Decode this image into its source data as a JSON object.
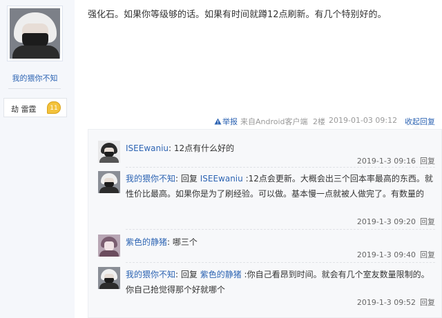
{
  "author": {
    "name": "我的猥你不知",
    "rank_name": "劫 雷霆",
    "level": "11"
  },
  "post": {
    "content": "强化石。如果你等级够的话。如果有时间就蹲12点刷新。有几个特别好的。",
    "report_label": "举报",
    "client": "来自Android客户端",
    "floor": "2楼",
    "time": "2019-01-03 09:12",
    "collapse_label": "收起回复"
  },
  "replies": [
    {
      "user": "ISEEwaniu",
      "prefix": "",
      "target": "",
      "text": ": 12点有什么好的",
      "time": "2019-1-3 09:16",
      "reply_label": "回复"
    },
    {
      "user": "我的猥你不知",
      "prefix": ": 回复 ",
      "target": "ISEEwaniu",
      "text": " :12点会更新。大概会出三个回本率最高的东西。就性价比最高。如果你是为了刷经验。可以做。基本慢一点就被人做完了。有数量的",
      "time": "2019-1-3 09:20",
      "reply_label": "回复"
    },
    {
      "user": "紫色的静猪",
      "prefix": "",
      "target": "",
      "text": ": 哪三个",
      "time": "2019-1-3 09:40",
      "reply_label": "回复"
    },
    {
      "user": "我的猥你不知",
      "prefix": ": 回复 ",
      "target": "紫色的静猪",
      "text": " :你自己看昂到时间。就会有几个室友数量限制的。你自己抢觉得那个好就哪个",
      "time": "2019-1-3 09:52",
      "reply_label": "回复"
    }
  ],
  "colors": {
    "link": "#2d64b3",
    "badge": "#f3c23c",
    "reply_bg": "#f7f8fa"
  }
}
